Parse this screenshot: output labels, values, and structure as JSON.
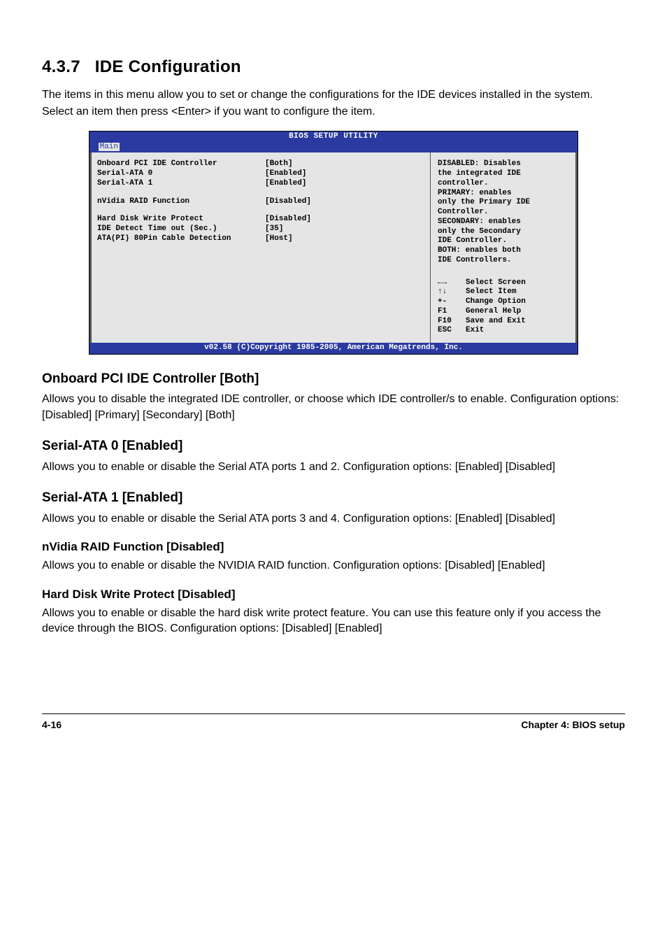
{
  "section": {
    "number": "4.3.7",
    "title": "IDE Configuration",
    "intro": "The items in this menu allow you to set or change the configurations for the IDE devices installed in the system. Select an item then press <Enter> if you want to configure the item."
  },
  "bios": {
    "title": "BIOS SETUP UTILITY",
    "active_tab": "Main",
    "items": [
      {
        "label": "Onboard PCI IDE Controller",
        "value": "[Both]"
      },
      {
        "label": "Serial-ATA 0",
        "value": "[Enabled]"
      },
      {
        "label": "Serial-ATA 1",
        "value": "[Enabled]"
      }
    ],
    "items2": [
      {
        "label": "nVidia RAID Function",
        "value": "[Disabled]"
      }
    ],
    "items3": [
      {
        "label": "Hard Disk Write Protect",
        "value": "[Disabled]"
      },
      {
        "label": "IDE Detect Time out (Sec.)",
        "value": "[35]"
      },
      {
        "label": "ATA(PI) 80Pin Cable Detection",
        "value": "[Host]"
      }
    ],
    "help": [
      "DISABLED: Disables",
      "the integrated IDE",
      "controller.",
      "PRIMARY: enables",
      "only the Primary IDE",
      "Controller.",
      "SECONDARY: enables",
      "only the Secondary",
      "IDE Controller.",
      "BOTH: enables both",
      "IDE Controllers."
    ],
    "keys": [
      {
        "k": "←→",
        "d": "Select Screen"
      },
      {
        "k": "↑↓",
        "d": "Select Item"
      },
      {
        "k": "+-",
        "d": "Change Option"
      },
      {
        "k": "F1",
        "d": "General Help"
      },
      {
        "k": "F10",
        "d": "Save and Exit"
      },
      {
        "k": "ESC",
        "d": "Exit"
      }
    ],
    "footer": "v02.58 (C)Copyright 1985-2005, American Megatrends, Inc."
  },
  "headings": {
    "h1": "Onboard PCI IDE Controller [Both]",
    "p1": "Allows you to disable the integrated IDE controller, or choose which IDE controller/s to enable. Configuration options: [Disabled] [Primary] [Secondary] [Both]",
    "h2": "Serial-ATA 0 [Enabled]",
    "p2": "Allows you to enable or disable the Serial ATA ports 1 and 2. Configuration options: [Enabled] [Disabled]",
    "h3": "Serial-ATA 1 [Enabled]",
    "p3": "Allows you to enable or disable the Serial ATA ports 3 and 4. Configuration options: [Enabled] [Disabled]",
    "h4": "nVidia RAID Function [Disabled]",
    "p4": "Allows you to enable or disable the NVIDIA RAID function. Configuration options: [Disabled] [Enabled]",
    "h5": "Hard Disk Write Protect [Disabled]",
    "p5": "Allows you to enable or disable the hard disk write protect feature. You can use this feature only if you access the device through the BIOS. Configuration options: [Disabled] [Enabled]"
  },
  "footer": {
    "left": "4-16",
    "right": "Chapter 4: BIOS setup"
  }
}
